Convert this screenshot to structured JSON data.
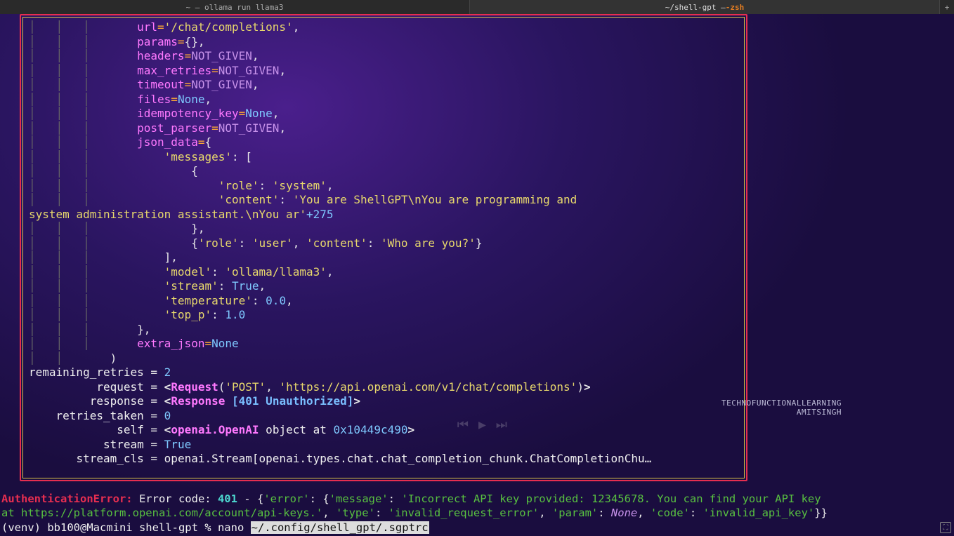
{
  "tabs": {
    "left": {
      "title": "~ — ollama run llama3"
    },
    "right": {
      "prefix": "~/shell-gpt — ",
      "suffix": "-zsh"
    }
  },
  "watermark": {
    "line1": "TECHNOFUNCTIONALLEARNING",
    "line2": "AMITSINGH"
  },
  "code": {
    "url_key": "url",
    "url_val": "'/chat/completions'",
    "params_key": "params",
    "params_val": "{}",
    "headers_key": "headers",
    "headers_val": "NOT_GIVEN",
    "max_retries_key": "max_retries",
    "max_retries_val": "NOT_GIVEN",
    "timeout_key": "timeout",
    "timeout_val": "NOT_GIVEN",
    "files_key": "files",
    "files_val": "None",
    "idem_key": "idempotency_key",
    "idem_val": "None",
    "post_parser_key": "post_parser",
    "post_parser_val": "NOT_GIVEN",
    "json_key": "json_data",
    "msgs_key": "'messages'",
    "role_key": "'role'",
    "role_sys_val": "'system'",
    "content_key": "'content'",
    "content_sys_val": "'You are ShellGPT\\nYou are programming and ",
    "content_sys_cont": "system administration assistant.\\nYou ar'",
    "plus275": "+275",
    "role_user_val": "'user'",
    "content_user_val": "'Who are you?'",
    "model_key": "'model'",
    "model_val": "'ollama/llama3'",
    "stream_key": "'stream'",
    "stream_val": "True",
    "temp_key": "'temperature'",
    "temp_val": "0.0",
    "topp_key": "'top_p'",
    "topp_val": "1.0",
    "extra_json_key": "extra_json",
    "extra_json_val": "None"
  },
  "vars": {
    "remaining_retries": {
      "label": "remaining_retries",
      "val": "2"
    },
    "request": {
      "label": "request",
      "open": "<",
      "cls": "Request",
      "method": "'POST'",
      "url": "'https://api.openai.com/v1/chat/completions'",
      "close": ">"
    },
    "response": {
      "label": "response",
      "open": "<",
      "cls": "Response",
      "status": "[401 Unauthorized]",
      "close": ">"
    },
    "retries_taken": {
      "label": "retries_taken",
      "val": "0"
    },
    "self": {
      "label": "self",
      "open": "<",
      "cls": "openai.OpenAI",
      "rest": " object at ",
      "addr": "0x10449c490",
      "close": ">"
    },
    "stream": {
      "label": "stream",
      "val": "True"
    },
    "stream_cls": {
      "label": "stream_cls",
      "val": "openai.Stream[openai.types.chat.chat_completion_chunk.ChatCompletionChu…"
    }
  },
  "error": {
    "name": "AuthenticationError:",
    "prefix": " Error code: ",
    "code": "401",
    "dash": " - ",
    "lbr": "{",
    "rbr": "}",
    "err_key": "'error'",
    "msg_key": "'message'",
    "msg_val": "'Incorrect API key provided: 12345678. You can find your API key ",
    "msg_cont_pre": "at ",
    "msg_url": "https://platform.openai.com/account/api-keys.'",
    "type_key": "'type'",
    "type_val": "'invalid_request_error'",
    "param_key": "'param'",
    "param_val": "None",
    "code_key": "'code'",
    "code_val": "'invalid_api_key'"
  },
  "prompt": {
    "prefix": "(venv) bb100@Macmini shell-gpt % ",
    "cmd": "nano ",
    "arg": "~/.config/shell_gpt/.sgptrc"
  }
}
